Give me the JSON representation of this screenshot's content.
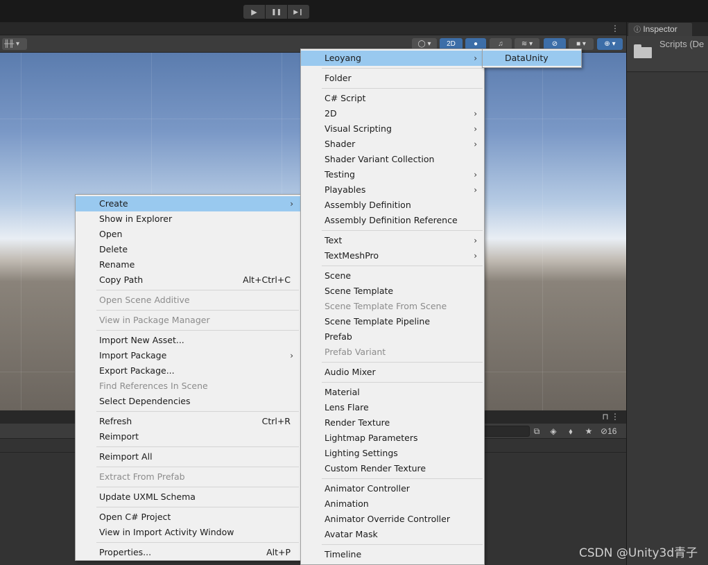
{
  "toolbar": {
    "play_icon": "▶",
    "pause_icon": "❚❚",
    "step_icon": "▶❙",
    "more_icon": "⋮",
    "twod_label": "2D",
    "gizmo_left": "╫╫ ▾"
  },
  "inspector": {
    "tab_label": "Inspector",
    "info_icon": "❶",
    "title": "Scripts (De"
  },
  "project": {
    "lock_icon": "🔓",
    "hidden_count": "16"
  },
  "main_menu": {
    "items": [
      {
        "label": "Create",
        "submenu": true,
        "selected": true
      },
      {
        "label": "Show in Explorer"
      },
      {
        "label": "Open"
      },
      {
        "label": "Delete"
      },
      {
        "label": "Rename"
      },
      {
        "label": "Copy Path",
        "shortcut": "Alt+Ctrl+C"
      },
      {
        "label": "Open Scene Additive",
        "disabled": true
      },
      {
        "label": "View in Package Manager",
        "disabled": true
      },
      {
        "label": "Import New Asset..."
      },
      {
        "label": "Import Package",
        "submenu": true
      },
      {
        "label": "Export Package..."
      },
      {
        "label": "Find References In Scene",
        "disabled": true
      },
      {
        "label": "Select Dependencies"
      },
      {
        "label": "Refresh",
        "shortcut": "Ctrl+R"
      },
      {
        "label": "Reimport"
      },
      {
        "label": "Reimport All"
      },
      {
        "label": "Extract From Prefab",
        "disabled": true
      },
      {
        "label": "Update UXML Schema"
      },
      {
        "label": "Open C# Project"
      },
      {
        "label": "View in Import Activity Window"
      },
      {
        "label": "Properties...",
        "shortcut": "Alt+P"
      }
    ]
  },
  "create_menu": {
    "items": [
      {
        "label": "Leoyang",
        "submenu": true,
        "selected": true
      },
      {
        "label": "Folder"
      },
      {
        "label": "C# Script"
      },
      {
        "label": "2D",
        "submenu": true
      },
      {
        "label": "Visual Scripting",
        "submenu": true
      },
      {
        "label": "Shader",
        "submenu": true
      },
      {
        "label": "Shader Variant Collection"
      },
      {
        "label": "Testing",
        "submenu": true
      },
      {
        "label": "Playables",
        "submenu": true
      },
      {
        "label": "Assembly Definition"
      },
      {
        "label": "Assembly Definition Reference"
      },
      {
        "label": "Text",
        "submenu": true
      },
      {
        "label": "TextMeshPro",
        "submenu": true
      },
      {
        "label": "Scene"
      },
      {
        "label": "Scene Template"
      },
      {
        "label": "Scene Template From Scene",
        "disabled": true
      },
      {
        "label": "Scene Template Pipeline"
      },
      {
        "label": "Prefab"
      },
      {
        "label": "Prefab Variant",
        "disabled": true
      },
      {
        "label": "Audio Mixer"
      },
      {
        "label": "Material"
      },
      {
        "label": "Lens Flare"
      },
      {
        "label": "Render Texture"
      },
      {
        "label": "Lightmap Parameters"
      },
      {
        "label": "Lighting Settings"
      },
      {
        "label": "Custom Render Texture"
      },
      {
        "label": "Animator Controller"
      },
      {
        "label": "Animation"
      },
      {
        "label": "Animator Override Controller"
      },
      {
        "label": "Avatar Mask"
      },
      {
        "label": "Timeline"
      }
    ]
  },
  "leoyang_menu": {
    "items": [
      {
        "label": "DataUnity",
        "selected": true
      }
    ]
  },
  "submenu_arrow": "›",
  "watermark": "CSDN @Unity3d青子",
  "colors": {
    "menu_bg": "#f0f0f0",
    "menu_highlight": "#99c9ef",
    "disabled_text": "#8c8c8c",
    "toolbar_active": "#3d6ea8"
  }
}
